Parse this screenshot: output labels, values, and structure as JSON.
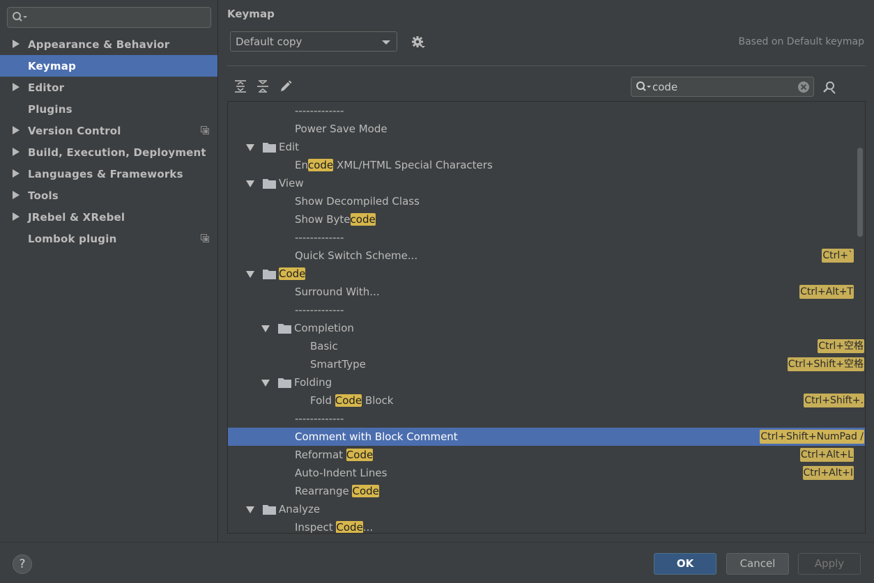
{
  "sidebar": {
    "search": {
      "value": "",
      "placeholder": ""
    },
    "items": [
      {
        "label": "Appearance & Behavior",
        "expandable": true,
        "selected": false,
        "project_icon": false
      },
      {
        "label": "Keymap",
        "expandable": false,
        "selected": true,
        "project_icon": false
      },
      {
        "label": "Editor",
        "expandable": true,
        "selected": false,
        "project_icon": false
      },
      {
        "label": "Plugins",
        "expandable": false,
        "selected": false,
        "project_icon": false
      },
      {
        "label": "Version Control",
        "expandable": true,
        "selected": false,
        "project_icon": true
      },
      {
        "label": "Build, Execution, Deployment",
        "expandable": true,
        "selected": false,
        "project_icon": false
      },
      {
        "label": "Languages & Frameworks",
        "expandable": true,
        "selected": false,
        "project_icon": false
      },
      {
        "label": "Tools",
        "expandable": true,
        "selected": false,
        "project_icon": false
      },
      {
        "label": "JRebel & XRebel",
        "expandable": true,
        "selected": false,
        "project_icon": false
      },
      {
        "label": "Lombok plugin",
        "expandable": false,
        "selected": false,
        "project_icon": true
      }
    ]
  },
  "main": {
    "title": "Keymap",
    "scheme": {
      "selected": "Default copy"
    },
    "based_on": "Based on Default keymap",
    "toolbar": {
      "icons": [
        "expand-all-icon",
        "collapse-all-icon",
        "edit-icon"
      ]
    },
    "filter": {
      "value": "code"
    },
    "tree": [
      {
        "level": 2,
        "kind": "separator",
        "parts": [
          [
            "-------------",
            false
          ]
        ],
        "shortcut": ""
      },
      {
        "level": 2,
        "kind": "action",
        "parts": [
          [
            "Power Save Mode",
            false
          ]
        ],
        "shortcut": ""
      },
      {
        "level": 1,
        "kind": "folder",
        "parts": [
          [
            "Edit",
            false
          ]
        ],
        "shortcut": ""
      },
      {
        "level": 2,
        "kind": "action",
        "parts": [
          [
            "En",
            false
          ],
          [
            "code",
            true
          ],
          [
            " XML/HTML Special Characters",
            false
          ]
        ],
        "shortcut": ""
      },
      {
        "level": 1,
        "kind": "folder",
        "parts": [
          [
            "View",
            false
          ]
        ],
        "shortcut": ""
      },
      {
        "level": 2,
        "kind": "action",
        "parts": [
          [
            "Show Decompiled Class",
            false
          ]
        ],
        "shortcut": ""
      },
      {
        "level": 2,
        "kind": "action",
        "parts": [
          [
            "Show Byte",
            false
          ],
          [
            "code",
            true
          ]
        ],
        "shortcut": ""
      },
      {
        "level": 2,
        "kind": "separator",
        "parts": [
          [
            "-------------",
            false
          ]
        ],
        "shortcut": ""
      },
      {
        "level": 2,
        "kind": "action",
        "parts": [
          [
            "Quick Switch Scheme...",
            false
          ]
        ],
        "shortcut": "Ctrl+`"
      },
      {
        "level": 1,
        "kind": "folder",
        "parts": [
          [
            "Code",
            true
          ]
        ],
        "shortcut": ""
      },
      {
        "level": 2,
        "kind": "action",
        "parts": [
          [
            "Surround With...",
            false
          ]
        ],
        "shortcut": "Ctrl+Alt+T"
      },
      {
        "level": 2,
        "kind": "separator",
        "parts": [
          [
            "-------------",
            false
          ]
        ],
        "shortcut": ""
      },
      {
        "level": 2,
        "kind": "folder",
        "parts": [
          [
            "Completion",
            false
          ]
        ],
        "shortcut": ""
      },
      {
        "level": 3,
        "kind": "action",
        "parts": [
          [
            "Basic",
            false
          ]
        ],
        "shortcut": "Ctrl+空格"
      },
      {
        "level": 3,
        "kind": "action",
        "parts": [
          [
            "SmartType",
            false
          ]
        ],
        "shortcut": "Ctrl+Shift+空格"
      },
      {
        "level": 2,
        "kind": "folder",
        "parts": [
          [
            "Folding",
            false
          ]
        ],
        "shortcut": ""
      },
      {
        "level": 3,
        "kind": "action",
        "parts": [
          [
            "Fold ",
            false
          ],
          [
            "Code",
            true
          ],
          [
            " Block",
            false
          ]
        ],
        "shortcut": "Ctrl+Shift+."
      },
      {
        "level": 2,
        "kind": "separator",
        "parts": [
          [
            "-------------",
            false
          ]
        ],
        "shortcut": ""
      },
      {
        "level": 2,
        "kind": "action",
        "parts": [
          [
            "Comment with Block Comment",
            false
          ]
        ],
        "shortcut": "Ctrl+Shift+NumPad /",
        "selected": true
      },
      {
        "level": 2,
        "kind": "action",
        "parts": [
          [
            "Reformat ",
            false
          ],
          [
            "Code",
            true
          ]
        ],
        "shortcut": "Ctrl+Alt+L"
      },
      {
        "level": 2,
        "kind": "action",
        "parts": [
          [
            "Auto-Indent Lines",
            false
          ]
        ],
        "shortcut": "Ctrl+Alt+I"
      },
      {
        "level": 2,
        "kind": "action",
        "parts": [
          [
            "Rearrange ",
            false
          ],
          [
            "Code",
            true
          ]
        ],
        "shortcut": ""
      },
      {
        "level": 1,
        "kind": "folder",
        "parts": [
          [
            "Analyze",
            false
          ]
        ],
        "shortcut": ""
      },
      {
        "level": 2,
        "kind": "action",
        "parts": [
          [
            "Inspect ",
            false
          ],
          [
            "Code",
            true
          ],
          [
            "...",
            false
          ]
        ],
        "shortcut": ""
      }
    ]
  },
  "footer": {
    "help_label": "?",
    "ok_label": "OK",
    "cancel_label": "Cancel",
    "apply_label": "Apply"
  },
  "colors": {
    "background": "#3c3f41",
    "selection": "#4b6eaf",
    "highlight": "#d7b74c",
    "ok_button": "#365880"
  }
}
